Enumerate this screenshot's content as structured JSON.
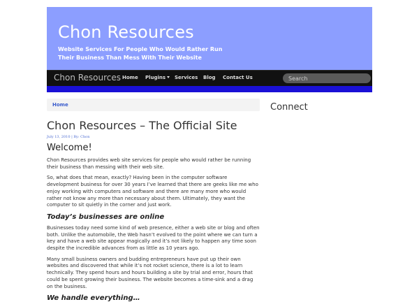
{
  "header": {
    "site_title": "Chon Resources",
    "tagline": "Website Services For People Who Would Rather Run Their Business Than Mess With Their Website"
  },
  "nav": {
    "brand": "Chon Resources",
    "items": [
      {
        "label": "Home"
      },
      {
        "label": "Plugins"
      },
      {
        "label": "Services"
      },
      {
        "label": "Blog"
      },
      {
        "label": "Contact Us"
      }
    ],
    "search_placeholder": "Search"
  },
  "breadcrumb": {
    "home": "Home"
  },
  "post": {
    "title": "Chon Resources – The Official Site",
    "meta": "July 13, 2010 | By: Chon",
    "heading": "Welcome!",
    "paragraphs": [
      "Chon Resources provides web site services for people who would rather be running their business than messing with their web site.",
      "So, what does that mean, exactly? Having been in the computer software development business for over 30 years I’ve learned that there are geeks like me who enjoy working with computers and software and there are many more who would rather not know any more than necessary about them. Ultimately, they want the computer to sit quietly in the corner and just work.",
      "Businesses today need some kind of web presence, either a web site or blog and often both. Unlike the automobile, the Web hasn’t evolved to the point where we can turn a key and have a web site appear magically and it’s not likely to happen any time soon despite the incredible advances from as little as 10 years ago.",
      "Many small business owners and budding entrepreneurs have put up their own websites and discovered that while it’s not rocket science, there is a lot to learn technically. They spend hours and hours building a site by trial and error, hours that could be spent growing their business. The website becomes a time-sink and a drag on the business."
    ],
    "section_1": "Today’s businesses are online",
    "section_2": "We handle everything…"
  },
  "sidebar": {
    "connect": "Connect"
  },
  "colors": {
    "header_bg": "#8c9eff",
    "nav_bg": "#111111",
    "accent_strip": "#1a10d6",
    "link": "#3a5ccc"
  }
}
